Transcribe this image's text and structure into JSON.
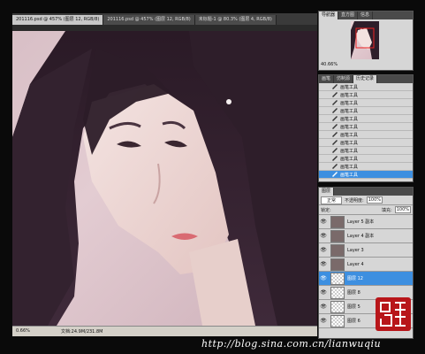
{
  "tabs": [
    {
      "label": "201116.psd @ 457% (图层 12, RGB/8)"
    },
    {
      "label": "201116.psd @ 457% (图层 12, RGB/8)"
    },
    {
      "label": "未标题-1 @ 80.3% (图层 4, RGB/8)"
    }
  ],
  "status": {
    "zoom": "0.66%",
    "docsize": "文档:24.9M/231.8M"
  },
  "navigator": {
    "tabs": [
      "导航器",
      "直方图",
      "信息"
    ],
    "zoom": "40.66%"
  },
  "history": {
    "tabs": [
      "画笔",
      "仿制源",
      "历史记录"
    ],
    "items": [
      "画笔工具",
      "画笔工具",
      "画笔工具",
      "画笔工具",
      "画笔工具",
      "画笔工具",
      "画笔工具",
      "画笔工具",
      "画笔工具",
      "画笔工具",
      "画笔工具",
      "画笔工具"
    ],
    "selected_index": 11
  },
  "layers": {
    "tabs": [
      "图层"
    ],
    "blend_mode": "正常",
    "opacity_label": "不透明度:",
    "opacity_value": "100%",
    "lock_label": "锁定:",
    "fill_label": "填充:",
    "fill_value": "100%",
    "items": [
      {
        "name": "Layer 5 副本"
      },
      {
        "name": "Layer 4 副本"
      },
      {
        "name": "Layer 3"
      },
      {
        "name": "Layer 4"
      },
      {
        "name": "图层 12"
      },
      {
        "name": "图层 8"
      },
      {
        "name": "图层 5"
      },
      {
        "name": "图层 6"
      }
    ],
    "selected_index": 4
  },
  "watermark": "http://blog.sina.com.cn/lianwuqiu",
  "colors": {
    "selection": "#3d8fe0",
    "stamp": "#b8161a"
  }
}
